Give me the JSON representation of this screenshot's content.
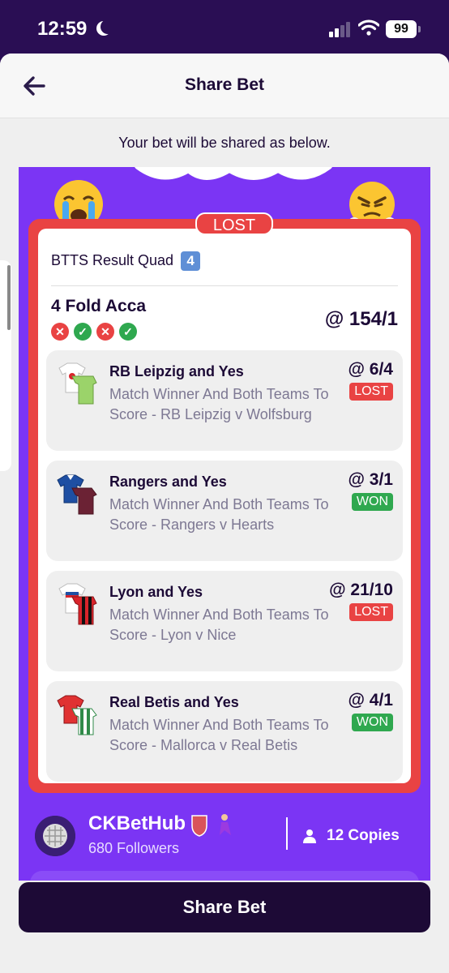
{
  "status_bar": {
    "time": "12:59",
    "battery": "99",
    "icons": [
      "moon-icon",
      "signal-icon",
      "wifi-icon",
      "battery-icon"
    ]
  },
  "header": {
    "title": "Share Bet",
    "back_icon": "arrow-left-icon"
  },
  "subtitle": "Your bet will be shared as below.",
  "card": {
    "result_tag": "LOST",
    "bet_name": "BTTS Result Quad",
    "bet_name_badge": "4",
    "acca_type": "4 Fold Acca",
    "acca_odds": "@ 154/1",
    "leg_results": [
      "lost",
      "won",
      "lost",
      "won"
    ],
    "legs": [
      {
        "title": "RB Leipzig and Yes",
        "description": "Match Winner And Both Teams To Score - RB Leipzig v Wolfsburg",
        "odds": "@ 6/4",
        "status": "LOST",
        "icon": "rb-leipzig-kit-icon"
      },
      {
        "title": "Rangers and Yes",
        "description": "Match Winner And Both Teams To Score - Rangers v Hearts",
        "odds": "@ 3/1",
        "status": "WON",
        "icon": "rangers-kit-icon"
      },
      {
        "title": "Lyon and Yes",
        "description": "Match Winner And Both Teams To Score - Lyon v Nice",
        "odds": "@ 21/10",
        "status": "LOST",
        "icon": "lyon-kit-icon"
      },
      {
        "title": "Real Betis and Yes",
        "description": "Match Winner And Both Teams To Score - Mallorca v Real Betis",
        "odds": "@ 4/1",
        "status": "WON",
        "icon": "real-betis-kit-icon"
      }
    ],
    "user": {
      "name": "CKBetHub",
      "followers": "680 Followers",
      "copies": "12 Copies"
    }
  },
  "share_button": "Share Bet",
  "colors": {
    "brand_purple": "#7b35f4",
    "dark": "#1d0a36",
    "lost_red": "#e94343",
    "won_green": "#2fa84f"
  }
}
